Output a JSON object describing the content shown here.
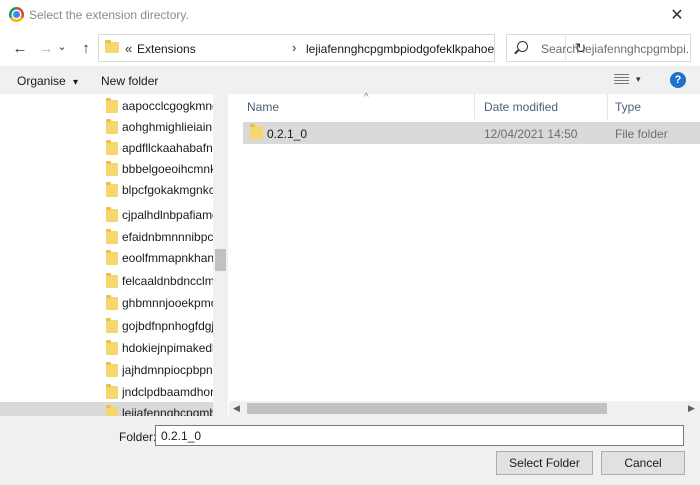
{
  "window": {
    "title": "Select the extension directory.",
    "close_glyph": "✕"
  },
  "navigation": {
    "back_glyph": "←",
    "forward_glyph": "→",
    "dropdown_glyph": "⌄",
    "up_glyph": "↑",
    "refresh_glyph": "↻"
  },
  "address_bar": {
    "overflow_glyph": "«",
    "separator_glyph": "›",
    "segments": [
      "Extensions",
      "lejiafennghcpgmbpiodgofeklkpahoe"
    ]
  },
  "search": {
    "placeholder": "Search lejiafennghcpgmbpi..."
  },
  "toolbar": {
    "organise_label": "Organise",
    "organise_caret": "▾",
    "new_folder_label": "New folder",
    "view_caret": "▾",
    "help_glyph": "?"
  },
  "nav_tree": {
    "items": [
      "aapocclcgogkmnckokdopfmhonfmgoek",
      "aohghmighlieiainnegkcijnfilokake",
      "apdfllckaahabafndbhieahigkjlhalf",
      "bbbelgoeoihcmnkbkbgmacogjhbaoego",
      "blpcfgokakmgnkcojhhkbfbldkacnbeo",
      "cjpalhdlnbpafiamejdnhcphjbkeiagm",
      "efaidnbmnnnibpcajpcglclefindmkaj",
      "eoolfmmapnkhandhbddkhmdmjohlbnph",
      "felcaaldnbdncclmgdcncolpebgiejap",
      "ghbmnnjooekpmoecnnnilnnbdlolhkhi",
      "gojbdfnpnhogfdgjbigejoaolejmgdhk",
      "hdokiejnpimakedhajhdlcegeplioahd",
      "jajhdmnpiocpbpnlhejbfelpbjfkekib",
      "jndclpdbaamdhonoechobihbbbmamlhc",
      "lejiafennghcpgmbpiodgofeklkpahoe"
    ],
    "selected_index": 14
  },
  "file_list": {
    "columns": {
      "name": "Name",
      "date_modified": "Date modified",
      "type": "Type"
    },
    "sort_glyph": "^",
    "rows": [
      {
        "name": "0.2.1_0",
        "date_modified": "12/04/2021 14:50",
        "type": "File folder"
      }
    ]
  },
  "scrollbar": {
    "left_glyph": "◀",
    "right_glyph": "▶"
  },
  "footer": {
    "folder_label": "Folder:",
    "folder_value": "0.2.1_0",
    "select_button": "Select Folder",
    "cancel_button": "Cancel"
  }
}
